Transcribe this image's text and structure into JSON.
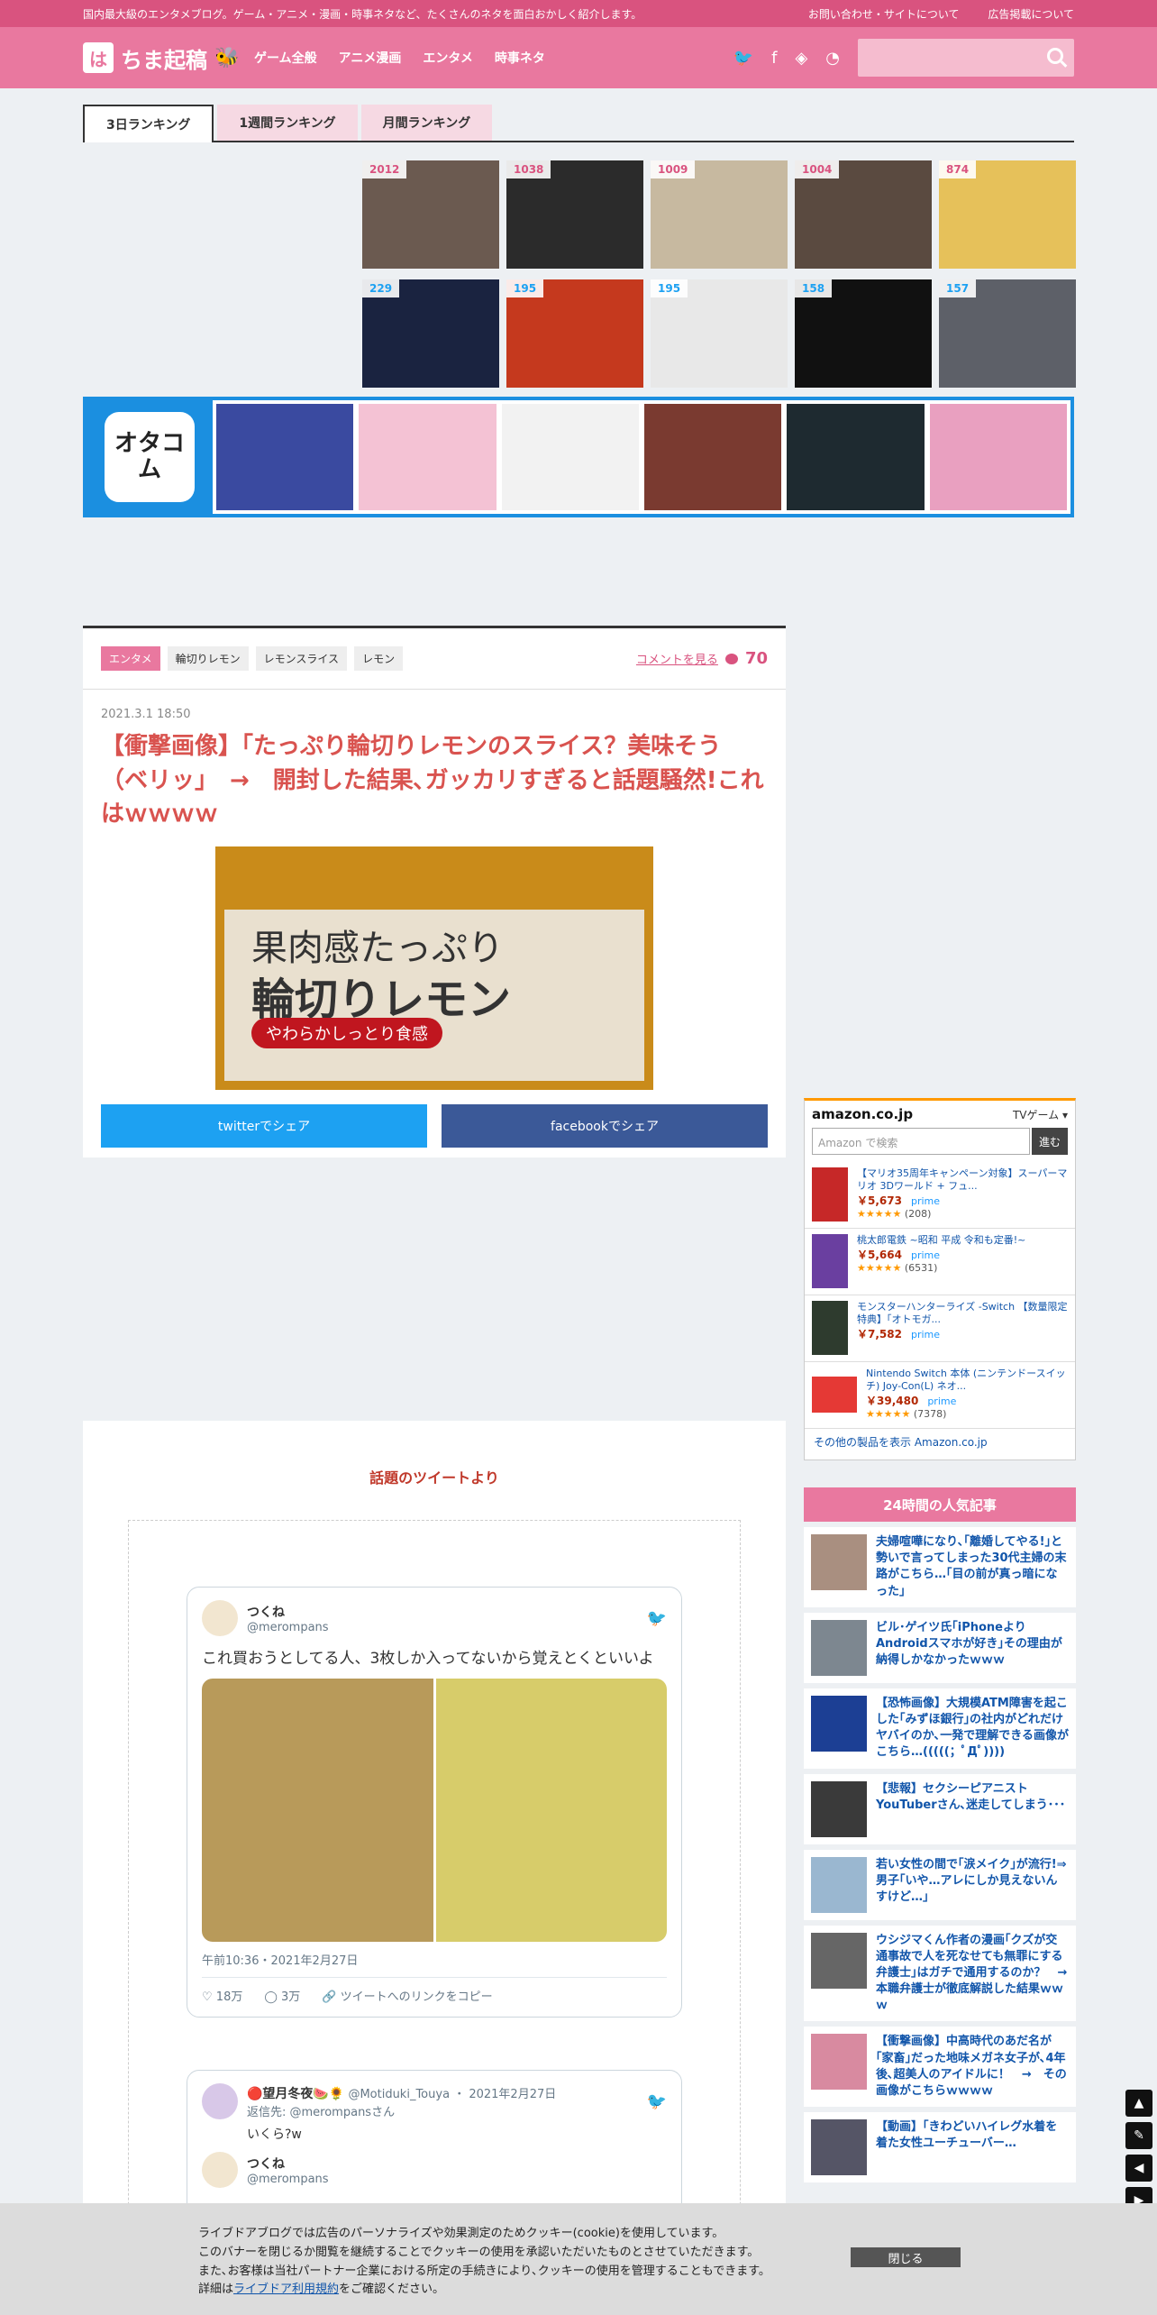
{
  "topbar": {
    "tagline": "国内最大級のエンタメブログ。ゲーム・アニメ・漫画・時事ネタなど、たくさんのネタを面白おかしく紹介します。",
    "links": [
      "お問い合わせ・サイトについて",
      "広告掲載について"
    ]
  },
  "header": {
    "logo_mark": "は",
    "logo_text": "ちま起稿",
    "nav": [
      "ゲーム全般",
      "アニメ漫画",
      "エンタメ",
      "時事ネタ"
    ]
  },
  "ranking": {
    "tabs": [
      "3日ランキング",
      "1週間ランキング",
      "月間ランキング"
    ],
    "comment_counts": [
      "2012",
      "1038",
      "1009",
      "1004",
      "874"
    ],
    "tweet_counts": [
      "229",
      "195",
      "195",
      "158",
      "157"
    ],
    "colors": [
      "#6b5a50",
      "#2b2b2b",
      "#c7b9a0",
      "#5a4a40",
      "#e6c15a",
      "#1a2340",
      "#c5391e",
      "#e8e8e8",
      "#111111",
      "#5d6068"
    ]
  },
  "otacom": {
    "logo": "オタコム"
  },
  "article": {
    "category": "エンタメ",
    "tags": [
      "輪切りレモン",
      "レモンスライス",
      "レモン"
    ],
    "comment_link": "コメントを見る",
    "comment_count": "70",
    "date": "2021.3.1 18:50",
    "title": "【衝撃画像】｢たっぷり輪切りレモンのスライス？美味そう（ベリッ」　→　開封した結果､ガッカリすぎると話題騒然!これはｗｗｗｗ",
    "hero": {
      "line1": "果肉感たっぷり",
      "line2": "輪切りレモン",
      "ribbon": "やわらかしっとり食感"
    },
    "share_twitter": "twitterでシェア",
    "share_facebook": "facebookでシェア"
  },
  "tweets": {
    "heading": "話題のツイートより",
    "t1": {
      "name": "つくね",
      "handle": "@merompans",
      "text": "これ買おうとしてる人、3枚しか入ってないから覚えとくといいよ",
      "time": "午前10:36・2021年2月27日",
      "likes": "18万",
      "retweets": "3万",
      "copy": "ツイートへのリンクをコピー"
    },
    "t2": {
      "name": "🔴望月冬夜🍉🌻",
      "handle": "@Motiduki_Touya",
      "date": "2021年2月27日",
      "reply_to": "返信先: @merompansさん",
      "text": "いくら?w",
      "quoted_name": "つくね",
      "quoted_handle": "@merompans"
    }
  },
  "amazon": {
    "logo": "amazon.co.jp",
    "category": "TVゲーム",
    "search_placeholder": "Amazon で検索",
    "search_button": "進む",
    "items": [
      {
        "title": "【マリオ35周年キャンペーン対象】スーパーマリオ 3Dワールド + フュ...",
        "price": "￥5,673",
        "prime": "prime",
        "reviews": "(208)"
      },
      {
        "title": "桃太郎電鉄 ~昭和 平成 令和も定番!~",
        "price": "￥5,664",
        "prime": "prime",
        "reviews": "(6531)"
      },
      {
        "title": "モンスターハンターライズ -Switch 【数量限定特典】「オトモガ...",
        "price": "￥7,582",
        "prime": "prime",
        "reviews": ""
      },
      {
        "title": "Nintendo Switch 本体 (ニンテンドースイッチ) Joy-Con(L) ネオ...",
        "price": "￥39,480",
        "prime": "prime",
        "reviews": "(7378)"
      }
    ],
    "more": "その他の製品を表示 Amazon.co.jp"
  },
  "popular": {
    "heading": "24時間の人気記事",
    "items": [
      "夫婦喧嘩になり､｢離婚してやる!｣と勢いで言ってしまった30代主婦の末路がこちら…｢目の前が真っ暗になった｣",
      "ビル･ゲイツ氏｢iPhoneよりAndroidスマホが好き｣その理由が納得しかなかったｗｗｗ",
      "【恐怖画像】大規模ATM障害を起こした｢みずほ銀行｣の社内がどれだけヤバイのか､一発で理解できる画像がこちら…(((((；ﾟДﾟ))))",
      "【悲報】セクシーピアニストYouTuberさん､迷走してしまう･･･",
      "若い女性の間で｢涙メイク｣が流行!⇒男子｢いや…アレにしか見えないんすけど…｣",
      "ウシジマくん作者の漫画｢クズが交通事故で人を死なせても無罪にする弁護士｣はガチで通用するのか？　→　本職弁護士が徹底解説した結果ｗｗｗ",
      "【衝撃画像】中高時代のあだ名が｢家畜｣だった地味メガネ女子が､4年後､超美人のアイドルに！　→　その画像がこちらｗｗｗｗ",
      "【動画】｢きわどいハイレグ水着を着た女性ユーチューバー…"
    ]
  },
  "cookie": {
    "line1": "ライブドアブログでは広告のパーソナライズや効果測定のためクッキー(cookie)を使用しています。",
    "line2": "このバナーを閉じるか閲覧を継続することでクッキーの使用を承認いただいたものとさせていただきます。",
    "line3": "また､お客様は当社パートナー企業における所定の手続きにより､クッキーの使用を管理することもできます。",
    "line4_pre": "詳細は",
    "line4_link": "ライブドア利用規約",
    "line4_post": "をご確認ください。",
    "close": "閉じる"
  }
}
